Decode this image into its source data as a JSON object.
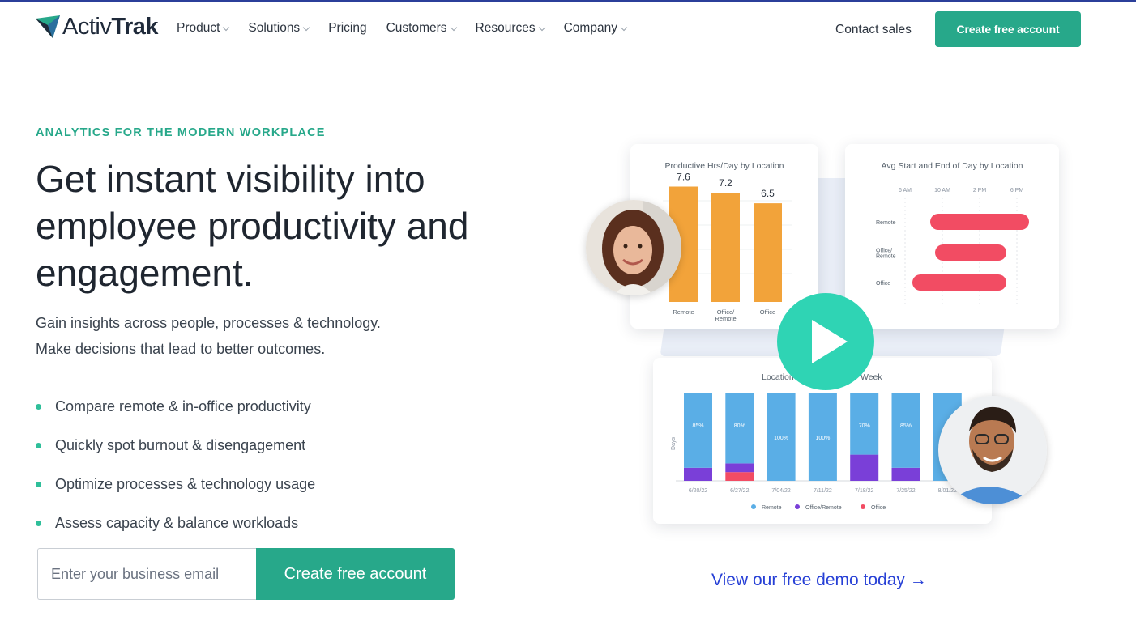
{
  "brand": {
    "name_light": "Activ",
    "name_bold": "Trak",
    "colors": {
      "accent": "#27a88a",
      "navy": "#1f2a3a",
      "play": "#2fd4b4",
      "link": "#2740d6"
    }
  },
  "nav": {
    "items": [
      {
        "label": "Product",
        "dropdown": true
      },
      {
        "label": "Solutions",
        "dropdown": true
      },
      {
        "label": "Pricing",
        "dropdown": false
      },
      {
        "label": "Customers",
        "dropdown": true
      },
      {
        "label": "Resources",
        "dropdown": true
      },
      {
        "label": "Company",
        "dropdown": true
      }
    ],
    "contact_label": "Contact sales",
    "cta_label": "Create free account"
  },
  "hero": {
    "eyebrow": "ANALYTICS FOR THE MODERN WORKPLACE",
    "headline": "Get instant visibility into employee productivity and engagement.",
    "subtext_line1": "Gain insights across people, processes & technology.",
    "subtext_line2": "Make decisions that lead to better outcomes.",
    "bullets": [
      "Compare remote & in-office productivity",
      "Quickly spot burnout & disengagement",
      "Optimize processes & technology usage",
      "Assess capacity & balance workloads"
    ],
    "email_placeholder": "Enter your business email",
    "submit_label": "Create free account"
  },
  "demo_link": "View our free demo today →",
  "chart_data": [
    {
      "type": "bar",
      "title": "Productive Hrs/Day by Location",
      "categories": [
        "Remote",
        "Office/ Remote",
        "Office"
      ],
      "values": [
        7.6,
        7.2,
        6.5
      ],
      "colors": [
        "#f2a33a"
      ]
    },
    {
      "type": "bar",
      "title": "Avg Start and End of Day by Location",
      "orientation": "horizontal-range",
      "x_ticks": [
        "6 AM",
        "10 AM",
        "2 PM",
        "6 PM"
      ],
      "categories": [
        "Remote",
        "Office/ Remote",
        "Office"
      ],
      "colors": [
        "#f24c63"
      ]
    },
    {
      "type": "bar",
      "title": "Location",
      "title_suffix": "Week",
      "stacked": true,
      "ylabel": "Days",
      "categories": [
        "6/20/22",
        "6/27/22",
        "7/04/22",
        "7/11/22",
        "7/18/22",
        "7/25/22",
        "8/01/22"
      ],
      "bar_labels": [
        "85%",
        "80%",
        "100%",
        "100%",
        "70%",
        "85%",
        ""
      ],
      "series": [
        {
          "name": "Remote",
          "color": "#5aaee6",
          "values": [
            85,
            80,
            100,
            100,
            70,
            85,
            100
          ]
        },
        {
          "name": "Office/Remote",
          "color": "#7a3fd8",
          "values": [
            15,
            10,
            0,
            0,
            30,
            15,
            0
          ]
        },
        {
          "name": "Office",
          "color": "#f24c63",
          "values": [
            0,
            10,
            0,
            0,
            0,
            0,
            0
          ]
        }
      ]
    }
  ]
}
